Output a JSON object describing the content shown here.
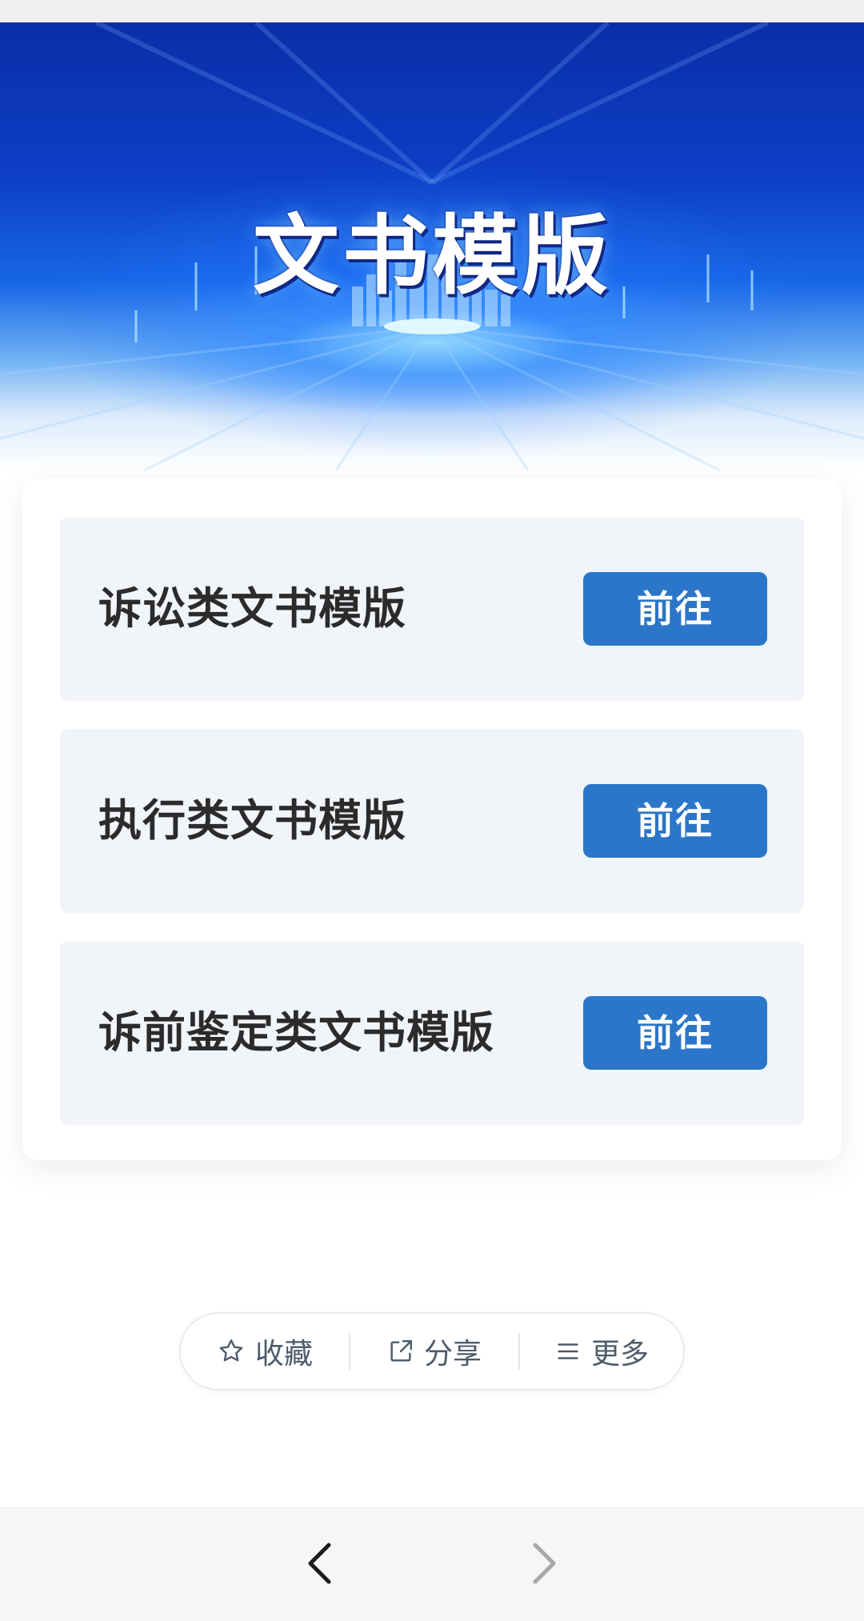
{
  "banner": {
    "title": "文书模版"
  },
  "templates": [
    {
      "label": "诉讼类文书模版",
      "button": "前往"
    },
    {
      "label": "执行类文书模版",
      "button": "前往"
    },
    {
      "label": "诉前鉴定类文书模版",
      "button": "前往"
    }
  ],
  "actions": {
    "favorite": {
      "label": "收藏",
      "icon": "star-icon"
    },
    "share": {
      "label": "分享",
      "icon": "share-icon"
    },
    "more": {
      "label": "更多",
      "icon": "menu-icon"
    }
  },
  "nav": {
    "back_icon": "chevron-left-icon",
    "forward_icon": "chevron-right-icon"
  },
  "colors": {
    "banner_blue": "#0d3fc6",
    "button_blue": "#2b76c8",
    "item_bg": "#f1f5f9"
  }
}
